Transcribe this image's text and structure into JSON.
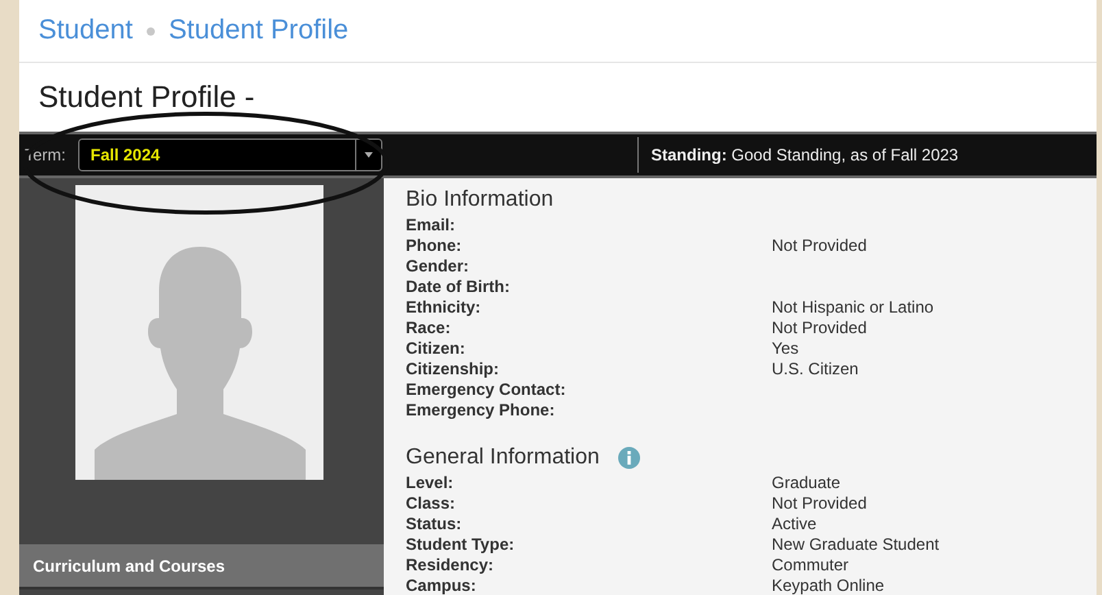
{
  "breadcrumb": [
    "Student",
    "Student Profile"
  ],
  "page_title": "Student Profile -",
  "term_bar": {
    "label": "Term:",
    "selected_term": "Fall 2024",
    "standing": "**Standing:** Good Standing, as of Fall 2023"
  },
  "sidebar": {
    "items": [
      {
        "label": "Curriculum and Courses",
        "selected": false
      }
    ]
  },
  "sections": [
    {
      "title": "Bio Information",
      "info": false,
      "rows": [
        {
          "label": "Email:"
        },
        {
          "label": "Phone:",
          "value": "Not Provided"
        },
        {
          "label": "Gender:"
        },
        {
          "label": "Date of Birth:"
        },
        {
          "label": "Ethnicity:",
          "value": "Not Hispanic or Latino"
        },
        {
          "label": "Race:",
          "value": "Not Provided"
        },
        {
          "label": "Citizen:",
          "value": "Yes"
        },
        {
          "label": "Citizenship:",
          "value": "U.S. Citizen"
        },
        {
          "label": "Emergency Contact:"
        },
        {
          "label": "Emergency Phone:"
        }
      ]
    },
    {
      "title": "General Information",
      "info": true,
      "rows": [
        {
          "label": "Level:",
          "value": "Graduate"
        },
        {
          "label": "Class:",
          "value": "Not Provided"
        },
        {
          "label": "Status:",
          "value": "Active"
        },
        {
          "label": "Student Type:",
          "value": "New Graduate Student"
        },
        {
          "label": "Residency:",
          "value": "Commuter"
        },
        {
          "label": "Campus:",
          "value": "Keypath Online"
        }
      ]
    }
  ]
}
